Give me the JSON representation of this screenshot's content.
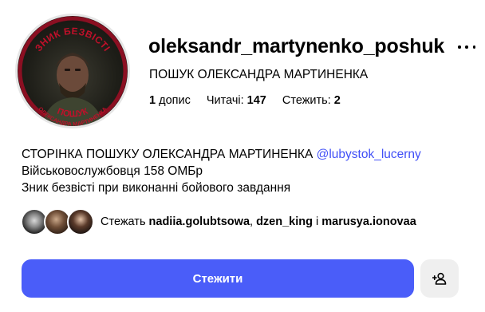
{
  "profile": {
    "username": "oleksandr_martynenko_poshuk",
    "full_name": "ПОШУК ОЛЕКСАНДРА МАРТИНЕНКА",
    "avatar_top_text": "ЗНИК БЕЗВІСТІ",
    "avatar_bottom_text": "ПОШУК",
    "avatar_bottom_small_text": "ОЛЕКСАНДРА МАРТИНЕНКА"
  },
  "stats": {
    "posts_count": "1",
    "posts_label": "допис",
    "followers_label": "Читачі:",
    "followers_count": "147",
    "following_label": "Стежить:",
    "following_count": "2"
  },
  "bio": {
    "line1_text": "СТОРІНКА ПОШУКУ ОЛЕКСАНДРА МАРТИНЕНКА",
    "line1_mention": "@lubystok_lucerny",
    "line2": "Військовослужбовця 158 ОМБр",
    "line3": "Зник безвісті при виконанні бойового завдання"
  },
  "followed_by": {
    "prefix": "Стежать",
    "user1": "nadiia.golubtsowa",
    "sep1": ",",
    "user2": "dzen_king",
    "conj": "і",
    "user3": "marusya.ionovaa"
  },
  "actions": {
    "follow_label": "Стежити"
  },
  "icons": {
    "more": "more-horizontal-icon",
    "suggest": "add-person-icon"
  },
  "colors": {
    "primary_button": "#4a5df9",
    "mention": "#4150f7",
    "avatar_text": "#c0102a"
  }
}
